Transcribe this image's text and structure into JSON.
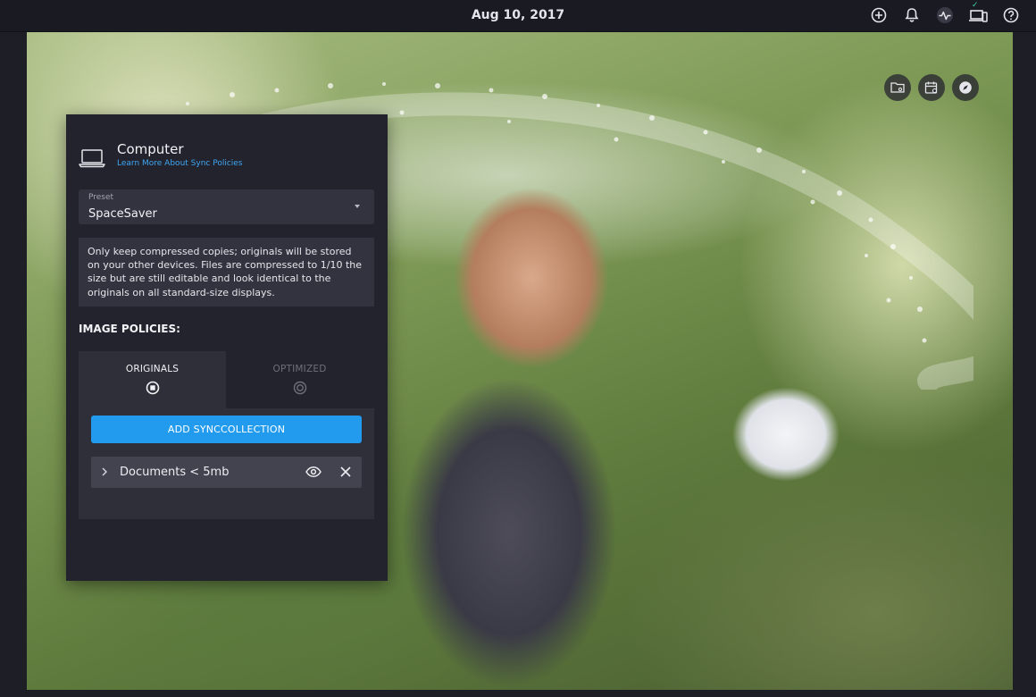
{
  "topbar": {
    "date": "Aug 10, 2017",
    "icons": [
      "plus-circle-icon",
      "bell-icon",
      "activity-icon",
      "devices-icon",
      "help-icon"
    ]
  },
  "photo_tools": [
    "folder-settings-icon",
    "calendar-settings-icon",
    "compass-icon"
  ],
  "panel": {
    "device_title": "Computer",
    "device_icon": "laptop-icon",
    "learn_more_link": "Learn More About Sync Policies",
    "preset": {
      "label": "Preset",
      "value": "SpaceSaver"
    },
    "description": "Only keep compressed copies; originals will be stored on your other devices. Files are compressed to 1/10 the size but are still editable and look identical to the originals on all standard-size displays.",
    "section_title": "IMAGE POLICIES:",
    "tabs": [
      {
        "label": "ORIGINALS",
        "active": true
      },
      {
        "label": "OPTIMIZED",
        "active": false
      }
    ],
    "add_button": "ADD SYNCCOLLECTION",
    "collections": [
      {
        "name": "Documents < 5mb"
      }
    ]
  },
  "colors": {
    "accent": "#229bef",
    "link": "#3ea7f3",
    "panel_bg": "#23232d",
    "topbar_bg": "#1a1a22"
  }
}
